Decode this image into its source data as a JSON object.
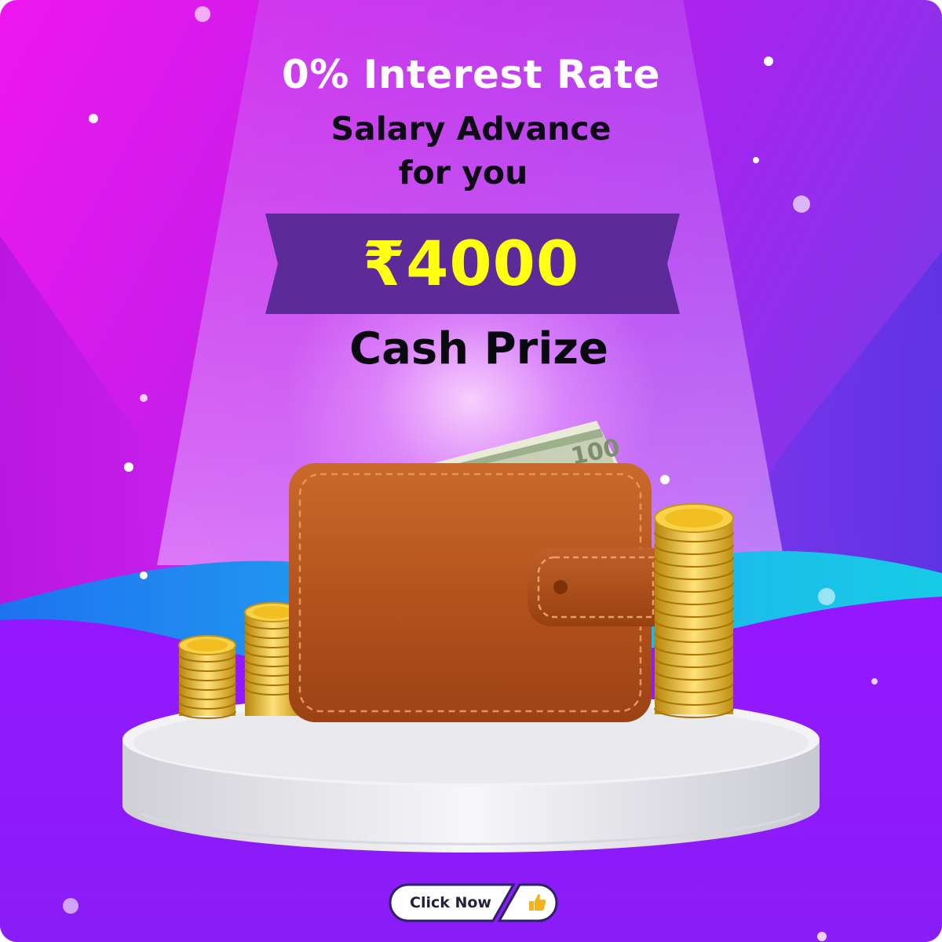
{
  "banner": {
    "headline": "0% Interest Rate",
    "subheadline_line1": "Salary Advance",
    "subheadline_line2": "for you",
    "amount": "₹4000",
    "prize_label": "Cash Prize",
    "banknote_text": "100"
  },
  "cta": {
    "label": "Click Now",
    "icon": "thumbs-up-icon"
  },
  "colors": {
    "background_start": "#ee17ee",
    "background_end": "#5f3ae0",
    "ribbon": "#5c2b99",
    "amount_text": "#ffff12",
    "wallet": "#b5531d",
    "coin": "#f2bf22"
  }
}
